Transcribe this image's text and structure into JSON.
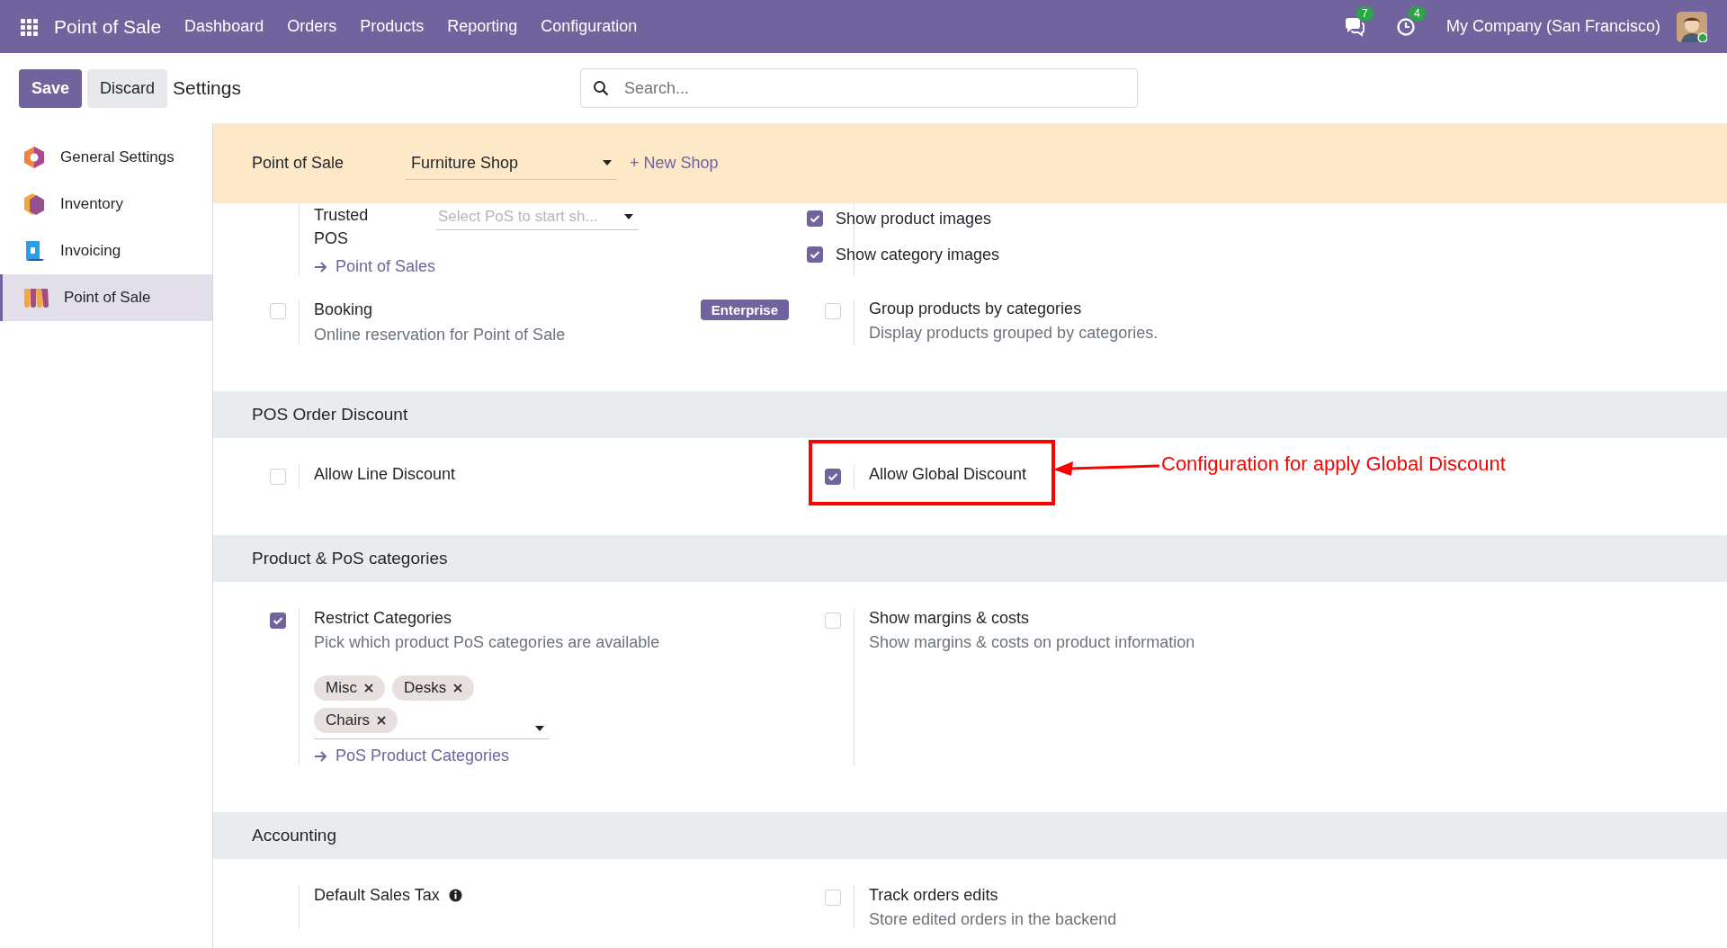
{
  "navbar": {
    "app_name": "Point of Sale",
    "menu": [
      "Dashboard",
      "Orders",
      "Products",
      "Reporting",
      "Configuration"
    ],
    "notifications": [
      {
        "kind": "messages",
        "count": "7"
      },
      {
        "kind": "activities",
        "count": "4"
      }
    ],
    "company": "My Company (San Francisco)"
  },
  "control_panel": {
    "buttons": [
      {
        "label": "Save",
        "kind": "primary"
      },
      {
        "label": "Discard",
        "kind": "secondary"
      }
    ],
    "breadcrumb": "Settings",
    "search": {
      "placeholder": "Search..."
    }
  },
  "sidebar": {
    "items": [
      {
        "label": "General Settings",
        "kind": "general",
        "selected": false
      },
      {
        "label": "Inventory",
        "kind": "inventory",
        "selected": false
      },
      {
        "label": "Invoicing",
        "kind": "invoicing",
        "selected": false
      },
      {
        "label": "Point of Sale",
        "kind": "pos",
        "selected": true
      }
    ]
  },
  "banner": {
    "label": "Point of Sale",
    "shop": "Furniture Shop",
    "new_shop": "+ New Shop"
  },
  "sections": [
    {
      "settings": [
        {
          "kind": "select",
          "label": "Trusted POS",
          "placeholder": "Select PoS to start sh...",
          "link": "Point of Sales"
        },
        {
          "kind": "checklist",
          "options": [
            {
              "label": "Show product images",
              "checked": true
            },
            {
              "label": "Show category images",
              "checked": true
            }
          ]
        },
        {
          "kind": "checkbox",
          "label": "Booking",
          "checked": false,
          "description": "Online reservation for Point of Sale",
          "badge": "Enterprise"
        },
        {
          "kind": "checkbox",
          "label": "Group products by categories",
          "checked": false,
          "description": "Display products grouped by categories."
        }
      ]
    },
    {
      "title": "POS Order Discount",
      "settings": [
        {
          "kind": "checkbox",
          "label": "Allow Line Discount",
          "checked": false
        },
        {
          "kind": "checkbox",
          "label": "Allow Global Discount",
          "checked": true,
          "annotation": "Configuration for apply Global Discount"
        }
      ]
    },
    {
      "title": "Product & PoS categories",
      "settings": [
        {
          "kind": "checkbox",
          "label": "Restrict Categories",
          "checked": true,
          "description": "Pick which product PoS categories are available",
          "tags": [
            "Misc",
            "Desks",
            "Chairs"
          ],
          "link": "PoS Product Categories"
        },
        {
          "kind": "checkbox",
          "label": "Show margins & costs",
          "checked": false,
          "description": "Show margins & costs on product information"
        }
      ]
    },
    {
      "title": "Accounting",
      "settings": [
        {
          "kind": "field",
          "label": "Default Sales Tax",
          "info": true
        },
        {
          "kind": "checkbox",
          "label": "Track orders edits",
          "checked": false,
          "description": "Store edited orders in the backend"
        }
      ]
    }
  ]
}
